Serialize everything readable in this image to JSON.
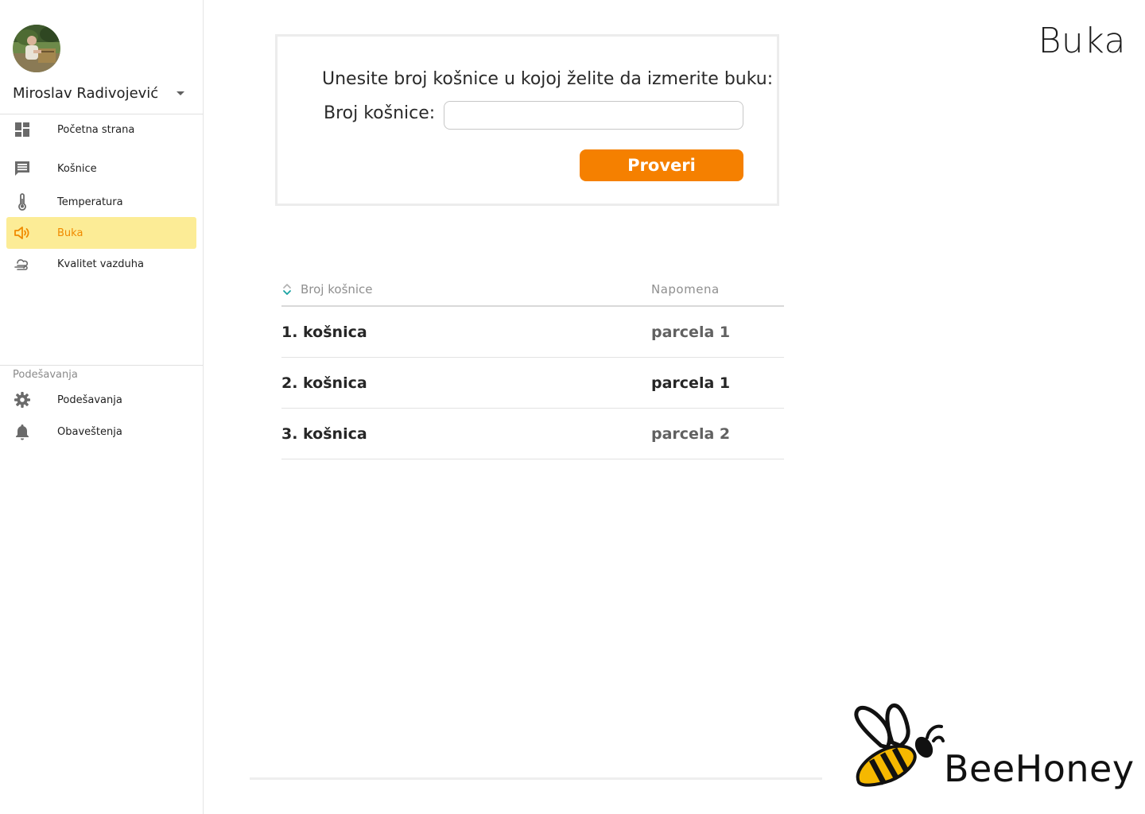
{
  "user": {
    "name": "Miroslav Radivojević"
  },
  "nav": {
    "items": [
      {
        "label": "Početna strana",
        "icon": "dashboard-icon"
      },
      {
        "label": "Košnice",
        "icon": "message-icon"
      },
      {
        "label": "Temperatura",
        "icon": "thermometer-icon"
      },
      {
        "label": "Buka",
        "icon": "speaker-icon",
        "active": true
      },
      {
        "label": "Kvalitet vazduha",
        "icon": "air-quality-icon"
      }
    ],
    "settings_section": "Podešavanja",
    "settings_items": [
      {
        "label": "Podešavanja",
        "icon": "gear-icon"
      },
      {
        "label": "Obaveštenja",
        "icon": "bell-icon"
      }
    ]
  },
  "page": {
    "title": "Buka"
  },
  "form": {
    "prompt": "Unesite broj košnice u kojoj želite da izmerite buku:",
    "field_label": "Broj košnice:",
    "input_value": "",
    "button_label": "Proveri"
  },
  "table": {
    "headers": [
      "Broj košnice",
      "Napomena"
    ],
    "rows": [
      {
        "hive": "1. košnica",
        "note": "parcela 1"
      },
      {
        "hive": "2. košnica",
        "note": "parcela 1"
      },
      {
        "hive": "3. košnica",
        "note": "parcela 2"
      }
    ]
  },
  "brand": {
    "name": "BeeHoney"
  },
  "colors": {
    "accent": "#f58000",
    "active_bg": "#fcec96",
    "active_text": "#f08a00",
    "sort_icon": "#1aa3a3"
  }
}
